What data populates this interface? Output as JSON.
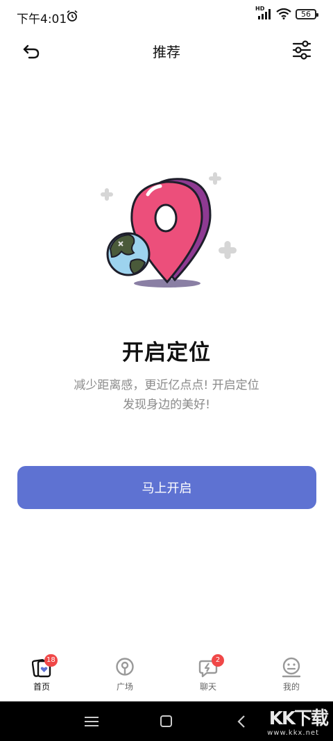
{
  "status_bar": {
    "time": "下午4:01",
    "network": "HD",
    "battery": "56"
  },
  "header": {
    "title": "推荐"
  },
  "main": {
    "headline": "开启定位",
    "description_line1": "减少距离感，更近亿点点! 开启定位",
    "description_line2": "发现身边的美好!",
    "button_label": "马上开启"
  },
  "tabbar": {
    "items": [
      {
        "label": "首页",
        "badge": "18",
        "icon": "home-cards-icon",
        "active": true
      },
      {
        "label": "广场",
        "badge": "",
        "icon": "location-pin-icon",
        "active": false
      },
      {
        "label": "聊天",
        "badge": "2",
        "icon": "chat-bolt-icon",
        "active": false
      },
      {
        "label": "我的",
        "badge": "",
        "icon": "smiley-profile-icon",
        "active": false
      }
    ]
  },
  "system_nav": {
    "watermark": "KK下载",
    "watermark_url": "www.kkx.net"
  },
  "colors": {
    "accent": "#5e72d2",
    "badge": "#f04848",
    "pin": "#ec4f7b"
  }
}
